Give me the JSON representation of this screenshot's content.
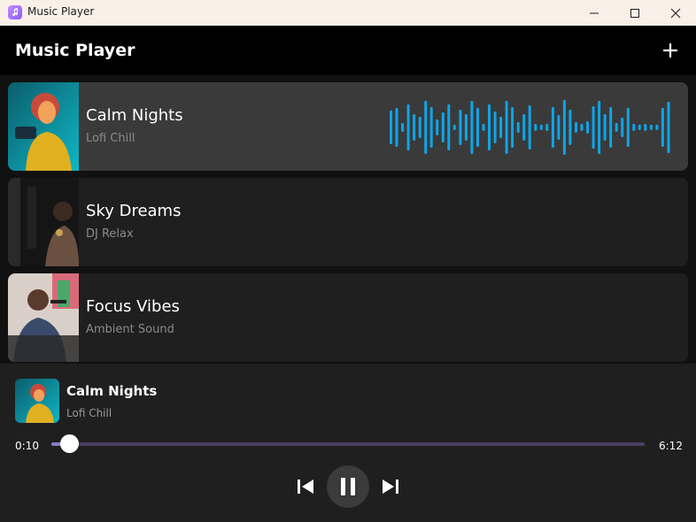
{
  "window": {
    "title": "Music Player",
    "icon": "music-note-icon"
  },
  "appbar": {
    "title": "Music Player",
    "add_icon": "plus-icon"
  },
  "tracks": [
    {
      "title": "Calm Nights",
      "artist": "Lofi Chill",
      "active": true
    },
    {
      "title": "Sky Dreams",
      "artist": "DJ Relax",
      "active": false
    },
    {
      "title": "Focus Vibes",
      "artist": "Ambient Sound",
      "active": false
    }
  ],
  "player": {
    "title": "Calm Nights",
    "artist": "Lofi Chill",
    "current_time": "0:10",
    "total_time": "6:12",
    "progress": 0.03,
    "state_icon": "pause-icon"
  },
  "colors": {
    "accent": "#0ea5e9",
    "progress_fill": "#8b79c9",
    "progress_track": "#4a3f63"
  }
}
